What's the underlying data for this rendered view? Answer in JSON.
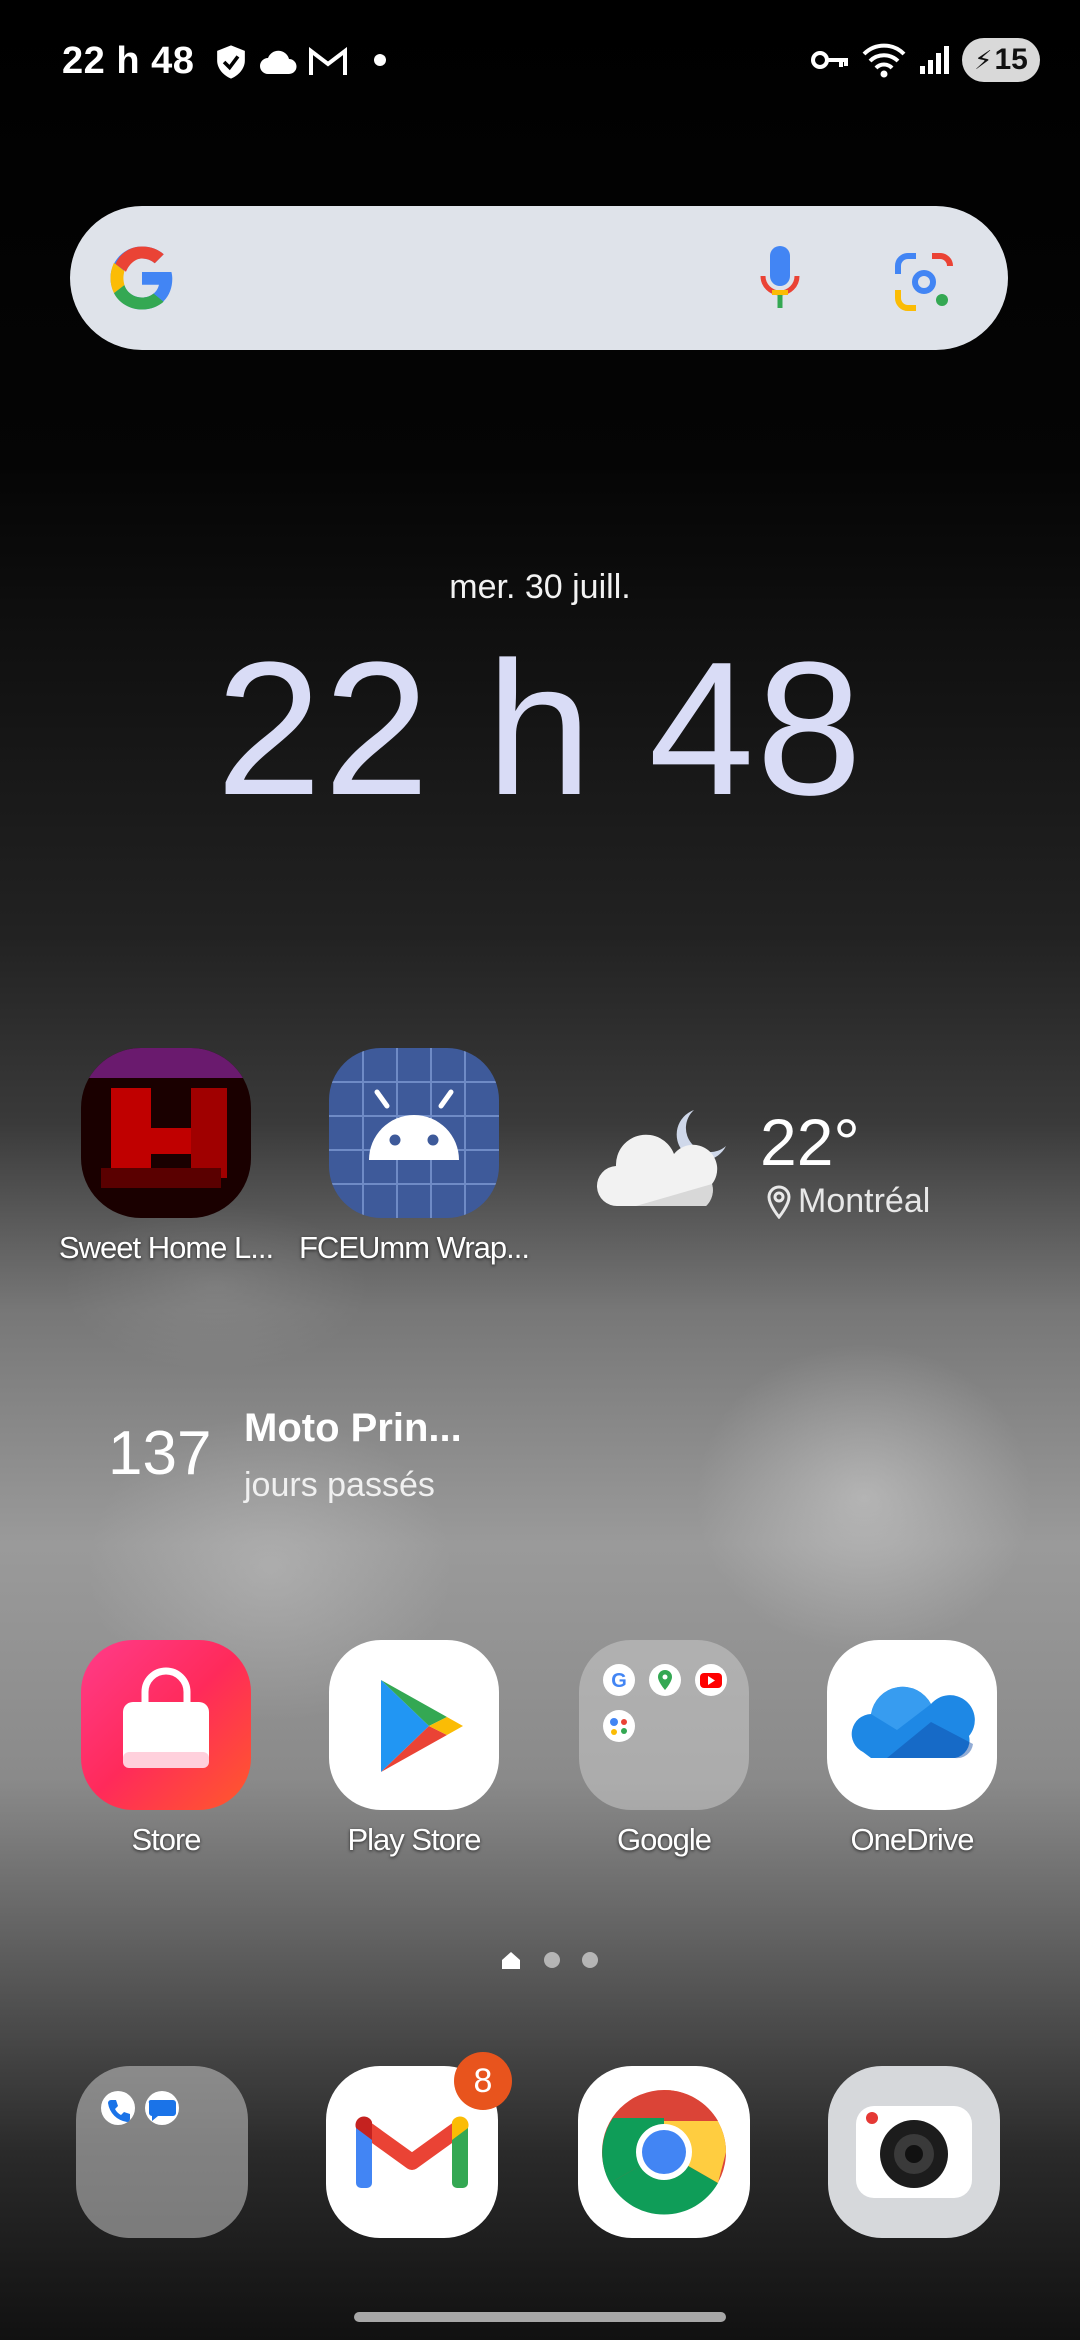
{
  "status_bar": {
    "time": "22 h 48",
    "battery": "15",
    "left_icons": [
      "shield-check-icon",
      "cloud-icon",
      "gmail-m-icon",
      "dot-icon"
    ],
    "right_icons": [
      "vpn-key-icon",
      "wifi-icon",
      "signal-icon",
      "battery-icon"
    ]
  },
  "search": {
    "icons": [
      "google-g-icon",
      "microphone-icon",
      "google-lens-icon"
    ]
  },
  "clock_widget": {
    "date": "mer. 30 juill.",
    "time": "22 h 48"
  },
  "apps_row1": [
    {
      "label": "Sweet Home L..."
    },
    {
      "label": "FCEUmm Wrap..."
    }
  ],
  "weather": {
    "temp": "22°",
    "location": "Montréal"
  },
  "countdown": {
    "number": "137",
    "title": "Moto Prin...",
    "subtitle": "jours passés"
  },
  "apps_row2": [
    {
      "label": "Store"
    },
    {
      "label": "Play Store"
    },
    {
      "label": "Google"
    },
    {
      "label": "OneDrive"
    }
  ],
  "dock": {
    "gmail_badge": "8",
    "items": [
      "phone-messages-folder",
      "gmail",
      "chrome",
      "camera"
    ]
  },
  "colors": {
    "clock": "#d9dcf6",
    "search_bg": "#dfe3ea",
    "badge": "#e8541d"
  }
}
